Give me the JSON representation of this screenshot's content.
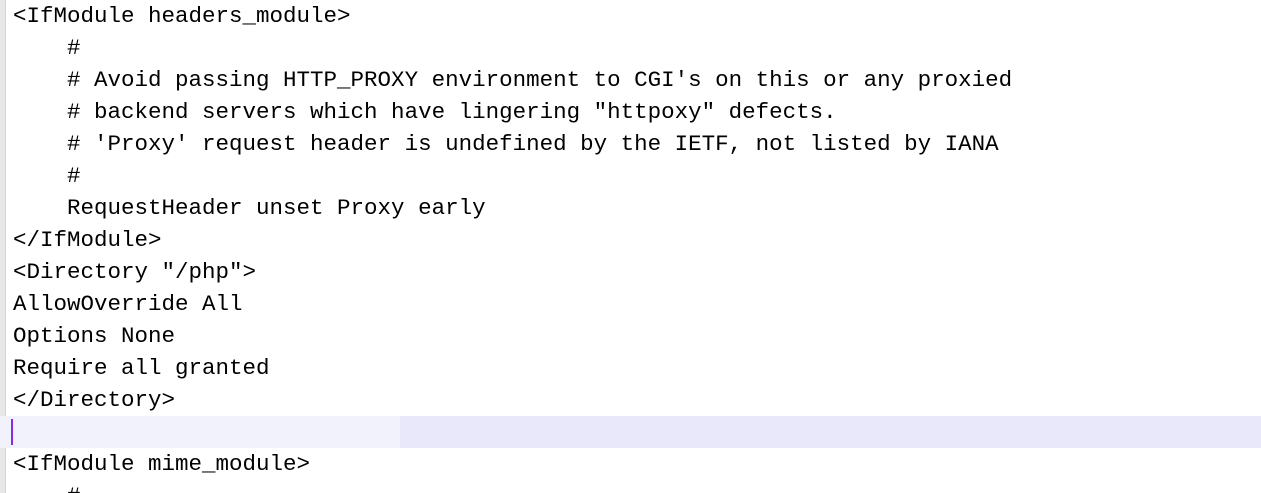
{
  "editor": {
    "lines": [
      "<IfModule headers_module>",
      "    #",
      "    # Avoid passing HTTP_PROXY environment to CGI's on this or any proxied",
      "    # backend servers which have lingering \"httpoxy\" defects.",
      "    # 'Proxy' request header is undefined by the IETF, not listed by IANA",
      "    #",
      "    RequestHeader unset Proxy early",
      "</IfModule>",
      "<Directory \"/php\">",
      "AllowOverride All",
      "Options None",
      "Require all granted",
      "</Directory>",
      "",
      "<IfModule mime_module>",
      "    #"
    ],
    "current_line_index": 13
  }
}
